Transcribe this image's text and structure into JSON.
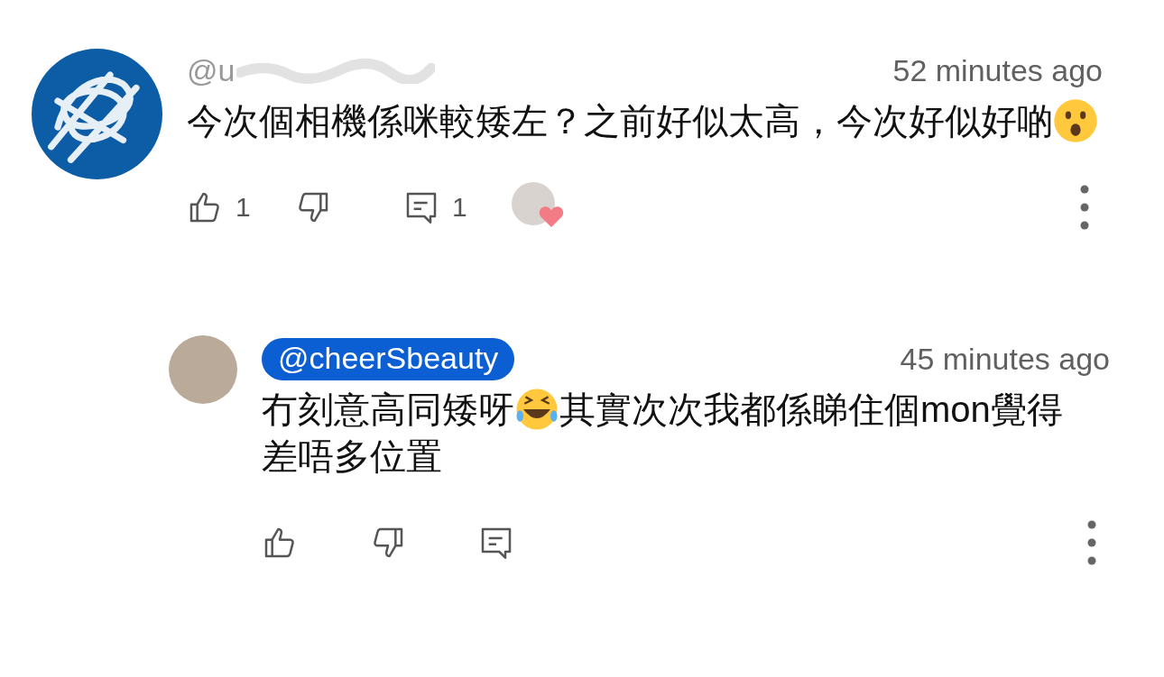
{
  "comments": [
    {
      "author": "@u",
      "author_obscured": true,
      "author_highlighted": false,
      "time": "52 minutes ago",
      "body": [
        {
          "kind": "text",
          "text": "今次個相機係咪較矮左？之前好似太高，今次好似好啲"
        },
        {
          "kind": "surprised-emoji"
        }
      ],
      "likes": "1",
      "replies": "1",
      "creator_heart": true,
      "is_reply": false
    },
    {
      "author": "@cheerSbeauty",
      "author_obscured": false,
      "author_highlighted": true,
      "time": "45 minutes ago",
      "body": [
        {
          "kind": "text",
          "text": "冇刻意高同矮呀"
        },
        {
          "kind": "laughing-emoji"
        },
        {
          "kind": "text",
          "text": "其實次次我都係睇住個mon覺得"
        },
        {
          "kind": "text",
          "text": "差唔多位置"
        }
      ],
      "creator_heart": false,
      "is_reply": true
    }
  ]
}
